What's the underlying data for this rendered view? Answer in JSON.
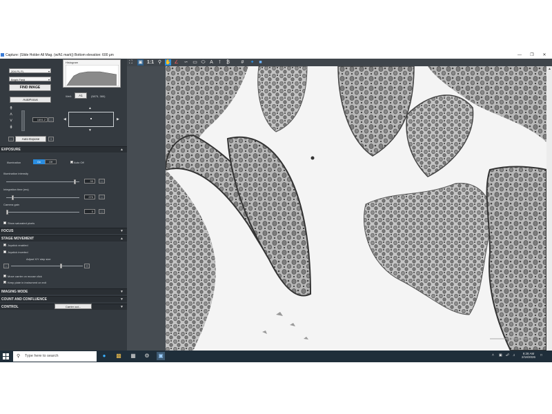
{
  "window": {
    "title": "Capture: (Slide Holder All Mag. (w/A1 mark)) Bottom elevation: 600 μm",
    "controls": [
      "minimize",
      "restore",
      "close"
    ]
  },
  "left_panel": {
    "objective_select": "20X PL FL",
    "channel_select": "Bright Field",
    "find_image_label": "FIND IMAGE",
    "histogram_label": "Histogram",
    "autofocus_label": "AutoFocus",
    "focus_value": "1691.2",
    "focus_more": "...",
    "auto_expose_label": "Auto Expose",
    "minus": "-",
    "plus": "+",
    "well_label": "Well:",
    "well_value": "A1",
    "well_coords": "(5875, 380)"
  },
  "exposure": {
    "header": "EXPOSURE",
    "illumination_label": "Illumination",
    "on_label": "On",
    "off_label": "Off",
    "auto_off_label": "Auto Off",
    "auto_off_checked": true,
    "illumination_intensity_label": "Illumination intensity",
    "illumination_intensity_value": "33",
    "illumination_intensity_level": 0.95,
    "integration_time_label": "Integration time (ms)",
    "integration_time_value": "270",
    "integration_time_level": 0.08,
    "camera_gain_label": "Camera gain",
    "camera_gain_value": "0",
    "camera_gain_level": 0.0,
    "show_saturated_label": "Show saturated pixels",
    "more_button": "..."
  },
  "focus": {
    "header": "FOCUS"
  },
  "stage_movement": {
    "header": "STAGE MOVEMENT",
    "joystick_enabled_label": "Joystick enabled",
    "joystick_inverted_label": "Joystick inverted",
    "step_size_label": "Adjust X/Y step size",
    "step_minus": "-",
    "step_plus": "+",
    "step_level": 0.7,
    "move_carrier_label": "Move carrier on mouse click",
    "keep_plate_label": "Keep plate in instrument on exit"
  },
  "imaging_mode": {
    "header": "IMAGING MODE"
  },
  "count_confluence": {
    "header": "COUNT AND CONFLUENCE"
  },
  "control": {
    "header": "CONTROL",
    "carrier_out_label": "Carrier out..."
  },
  "toolbar": {
    "zoom_label": "1:1"
  },
  "taskbar": {
    "search_placeholder": "Type here to search",
    "time": "9:28 AM",
    "date": "2/18/2026"
  },
  "colors": {
    "panel_bg": "#343a40",
    "accent_blue": "#2a8de0",
    "taskbar_bg": "#1f2e3a"
  }
}
